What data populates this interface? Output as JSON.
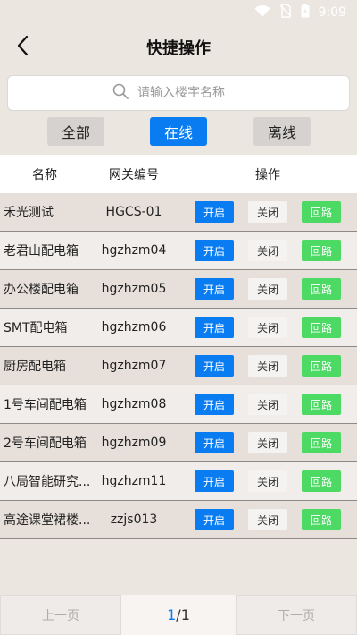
{
  "status_bar": {
    "time": "9:09",
    "icons": [
      "wifi-icon",
      "no-sim-icon",
      "battery-icon"
    ]
  },
  "header": {
    "title": "快捷操作",
    "back_icon": "chevron-left-icon"
  },
  "search": {
    "placeholder": "请输入楼宇名称",
    "value": "",
    "icon": "search-icon"
  },
  "tabs": [
    {
      "label": "全部",
      "active": false
    },
    {
      "label": "在线",
      "active": true
    },
    {
      "label": "离线",
      "active": false
    }
  ],
  "table": {
    "columns": {
      "name": "名称",
      "code": "网关编号",
      "action": "操作"
    },
    "rows": [
      {
        "name": "禾光测试",
        "code": "HGCS-01"
      },
      {
        "name": "老君山配电箱",
        "code": "hgzhzm04"
      },
      {
        "name": "办公楼配电箱",
        "code": "hgzhzm05"
      },
      {
        "name": "SMT配电箱",
        "code": "hgzhzm06"
      },
      {
        "name": "厨房配电箱",
        "code": "hgzhzm07"
      },
      {
        "name": "1号车间配电箱",
        "code": "hgzhzm08"
      },
      {
        "name": "2号车间配电箱",
        "code": "hgzhzm09"
      },
      {
        "name": "八局智能研究...",
        "code": "hgzhzm11"
      },
      {
        "name": "高途课堂裙楼...",
        "code": "zzjs013"
      }
    ],
    "buttons": {
      "open": "开启",
      "close": "关闭",
      "loop": "回路"
    }
  },
  "pager": {
    "prev": "上一页",
    "next": "下一页",
    "current": "1",
    "separator": "/",
    "total": "1"
  },
  "colors": {
    "accent": "#0a7cf2",
    "loop": "#4cd964",
    "background": "#ece6e1"
  }
}
